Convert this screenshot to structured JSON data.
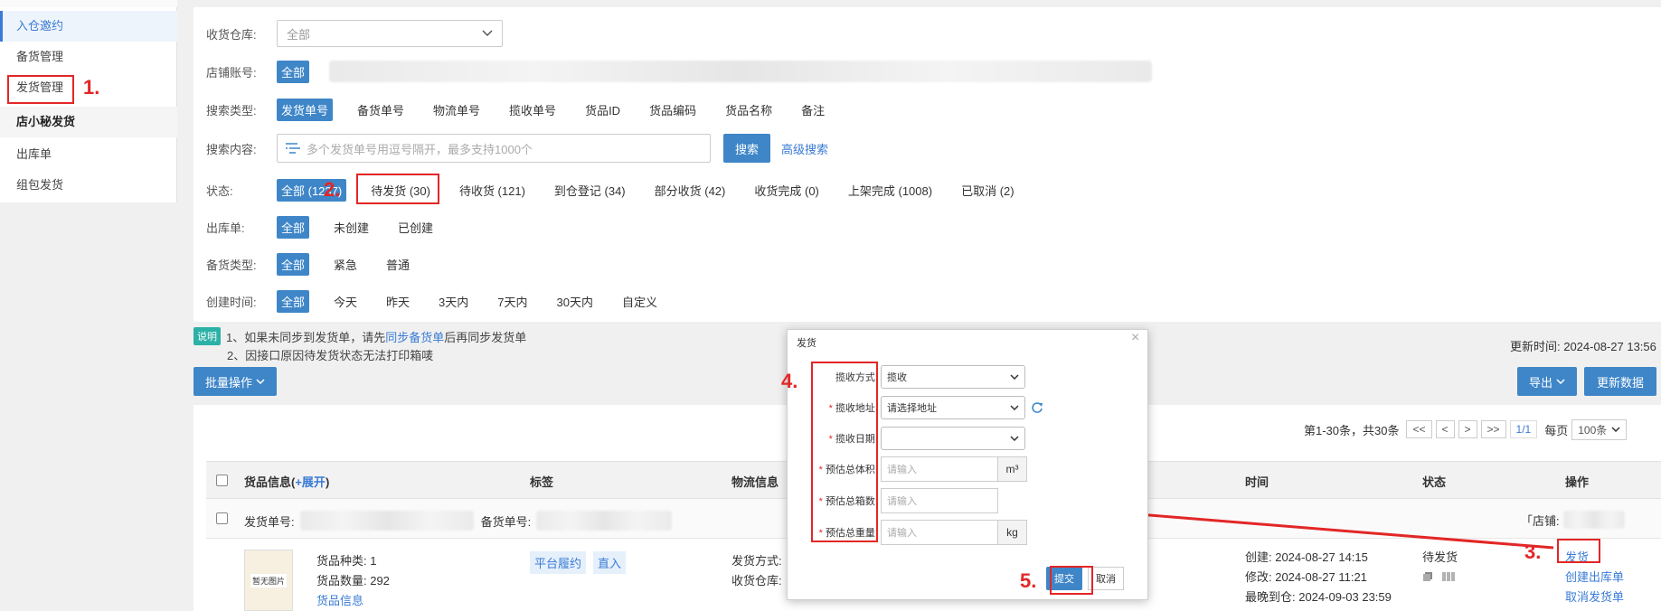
{
  "sidebar": {
    "items": [
      {
        "label": "入仓邀约",
        "active": true
      },
      {
        "label": "备货管理"
      },
      {
        "label": "发货管理"
      },
      {
        "label": "店小秘发货",
        "group": true
      },
      {
        "label": "出库单"
      },
      {
        "label": "组包发货"
      }
    ]
  },
  "filters": {
    "warehouse": {
      "label": "收货仓库:",
      "value": "全部"
    },
    "store": {
      "label": "店铺账号:",
      "selected": "全部"
    },
    "search_type": {
      "label": "搜索类型:",
      "options": [
        "发货单号",
        "备货单号",
        "物流单号",
        "揽收单号",
        "货品ID",
        "货品编码",
        "货品名称",
        "备注"
      ]
    },
    "search_content": {
      "label": "搜索内容:",
      "placeholder": "多个发货单号用逗号隔开，最多支持1000个",
      "search_button": "搜索",
      "advanced": "高级搜索"
    },
    "status": {
      "label": "状态:",
      "options": [
        "全部 (1237)",
        "待发货 (30)",
        "待收货 (121)",
        "到仓登记 (34)",
        "部分收货 (42)",
        "收货完成 (0)",
        "上架完成 (1008)",
        "已取消 (2)"
      ]
    },
    "outbound": {
      "label": "出库单:",
      "options": [
        "全部",
        "未创建",
        "已创建"
      ]
    },
    "stock_type": {
      "label": "备货类型:",
      "options": [
        "全部",
        "紧急",
        "普通"
      ]
    },
    "created_time": {
      "label": "创建时间:",
      "options": [
        "全部",
        "今天",
        "昨天",
        "3天内",
        "7天内",
        "30天内",
        "自定义"
      ]
    }
  },
  "notes": {
    "tag": "说明",
    "line1_prefix": "1、如果未同步到发货单，请先",
    "line1_link": "同步备货单",
    "line1_suffix": "后再同步发货单",
    "line2": "2、因接口原因待发货状态无法打印箱唛"
  },
  "actions": {
    "batch": "批量操作",
    "updated": "更新时间: 2024-08-27 13:56",
    "export": "导出",
    "refresh": "更新数据"
  },
  "pager": {
    "summary": "第1-30条，共30条",
    "buttons": [
      "<<",
      "<",
      ">",
      ">>"
    ],
    "page": "1/1",
    "per_page_label": "每页",
    "per_page": "100条"
  },
  "table": {
    "headers": {
      "goods_prefix": "货品信息(",
      "goods_expand": "+展开",
      "goods_suffix": ")",
      "tags": "标签",
      "logistics": "物流信息",
      "time": "时间",
      "status": "状态",
      "ops": "操作"
    },
    "row": {
      "ship_no_label": "发货单号:",
      "stock_no_label": "备货单号:",
      "store_label": "「店铺:",
      "no_image": "暂无图片",
      "kinds": "货品种类: 1",
      "qty": "货品数量: 292",
      "goods_info": "货品信息",
      "tag1": "平台履约",
      "tag2": "直入",
      "ship_method": "发货方式:",
      "recv_wh": "收货仓库:",
      "created": "创建: 2024-08-27 14:15",
      "modified": "修改: 2024-08-27 11:21",
      "latest": "最晚到仓: 2024-09-03 23:59",
      "status": "待发货",
      "op_ship": "发货",
      "op_create": "创建出库单",
      "op_cancel": "取消发货单"
    }
  },
  "modal": {
    "title": "发货",
    "close": "×",
    "fields": [
      {
        "label": "揽收方式:",
        "value": "揽收",
        "type": "select",
        "required": false
      },
      {
        "label": "揽收地址:",
        "value": "请选择地址",
        "type": "select",
        "required": true
      },
      {
        "label": "揽收日期:",
        "value": "",
        "type": "select",
        "required": true
      },
      {
        "label": "预估总体积:",
        "placeholder": "请输入",
        "unit": "m³",
        "type": "input",
        "required": true
      },
      {
        "label": "预估总箱数:",
        "placeholder": "请输入",
        "unit": "",
        "type": "input",
        "required": true
      },
      {
        "label": "预估总重量:",
        "placeholder": "请输入",
        "unit": "kg",
        "type": "input",
        "required": true
      }
    ],
    "submit": "提交",
    "cancel": "取消"
  },
  "annotations": [
    "1.",
    "2.",
    "3.",
    "4.",
    "5."
  ],
  "colors": {
    "accent": "#3f86c8",
    "annotation": "#e32626",
    "note_tag": "#2bb1a6"
  }
}
